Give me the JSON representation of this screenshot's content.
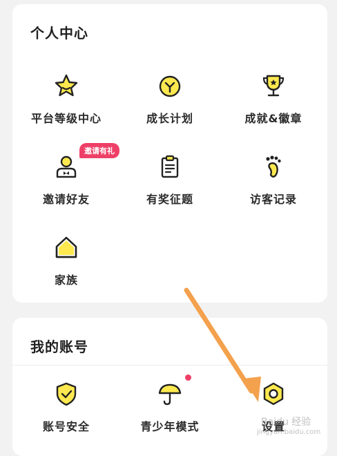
{
  "personal_center": {
    "title": "个人中心",
    "items": [
      {
        "label": "平台等级中心",
        "icon": "star-icon"
      },
      {
        "label": "成长计划",
        "icon": "clock-icon"
      },
      {
        "label": "成就&徽章",
        "icon": "trophy-icon"
      },
      {
        "label": "邀请好友",
        "icon": "person-icon",
        "badge": "邀请有礼"
      },
      {
        "label": "有奖征题",
        "icon": "clipboard-icon"
      },
      {
        "label": "访客记录",
        "icon": "footprint-icon"
      },
      {
        "label": "家族",
        "icon": "house-icon"
      }
    ]
  },
  "my_account": {
    "title": "我的账号",
    "items": [
      {
        "label": "账号安全",
        "icon": "shield-icon"
      },
      {
        "label": "青少年模式",
        "icon": "umbrella-icon"
      },
      {
        "label": "设置",
        "icon": "hexagon-nut-icon"
      }
    ]
  },
  "colors": {
    "accent_yellow": "#fde94f",
    "badge_red": "#ee3f67",
    "arrow_orange": "#f4a14d"
  },
  "watermark": {
    "text": "Baidu 经验",
    "url": "jingyan.baidu.com"
  }
}
